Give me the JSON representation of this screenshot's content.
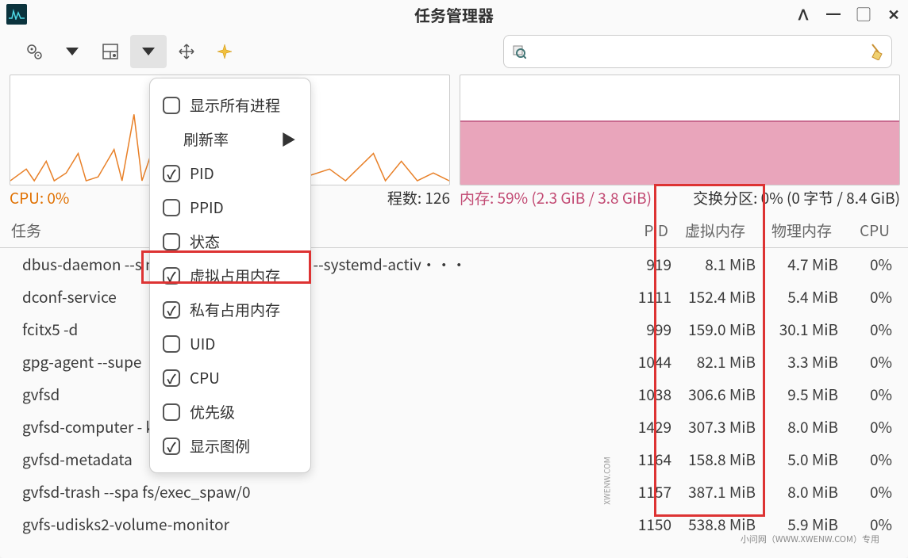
{
  "window": {
    "title": "任务管理器"
  },
  "legends": {
    "cpu": "CPU: 0%",
    "procs": "程数: 126",
    "mem": "内存: 59% (2.3 GiB / 3.8 GiB)",
    "swap": "交换分区: 0% (0 字节 / 8.4 GiB)"
  },
  "columns": {
    "task": "任务",
    "pid": "PID",
    "vmem": "虚拟内存",
    "rmem": "物理内存",
    "cpu": "CPU"
  },
  "rows": [
    {
      "task": "dbus-daemon --s                         md: --nofork --nopidfile --systemd-activ···",
      "pid": "919",
      "vmem": "8.1 MiB",
      "rmem": "4.7 MiB",
      "cpu": "0%"
    },
    {
      "task": "dconf-service",
      "pid": "1111",
      "vmem": "152.4 MiB",
      "rmem": "5.4 MiB",
      "cpu": "0%"
    },
    {
      "task": "fcitx5 -d",
      "pid": "999",
      "vmem": "159.0 MiB",
      "rmem": "30.1 MiB",
      "cpu": "0%"
    },
    {
      "task": "gpg-agent --supe",
      "pid": "1044",
      "vmem": "82.1 MiB",
      "rmem": "3.3 MiB",
      "cpu": "0%"
    },
    {
      "task": "gvfsd",
      "pid": "1038",
      "vmem": "306.6 MiB",
      "rmem": "9.5 MiB",
      "cpu": "0%"
    },
    {
      "task": "gvfsd-computer -                         k/gvfs/exec_spaw/1",
      "pid": "1429",
      "vmem": "307.3 MiB",
      "rmem": "8.0 MiB",
      "cpu": "0%"
    },
    {
      "task": "gvfsd-metadata",
      "pid": "1164",
      "vmem": "158.8 MiB",
      "rmem": "5.0 MiB",
      "cpu": "0%"
    },
    {
      "task": "gvfsd-trash --spa                         fs/exec_spaw/0",
      "pid": "1157",
      "vmem": "387.1 MiB",
      "rmem": "8.0 MiB",
      "cpu": "0%"
    },
    {
      "task": "gvfs-udisks2-volume-monitor",
      "pid": "1150",
      "vmem": "538.8 MiB",
      "rmem": "5.9 MiB",
      "cpu": "0%"
    }
  ],
  "menu": {
    "show_all": "显示所有进程",
    "refresh": "刷新率",
    "pid": "PID",
    "ppid": "PPID",
    "status": "状态",
    "vmem": "虚拟占用内存",
    "pmem": "私有占用内存",
    "uid": "UID",
    "cpu": "CPU",
    "priority": "优先级",
    "legend": "显示图例"
  },
  "watermark": {
    "side": "XWENW.COM",
    "bottom": "小问网（WWW.XWENW.COM）专用"
  }
}
